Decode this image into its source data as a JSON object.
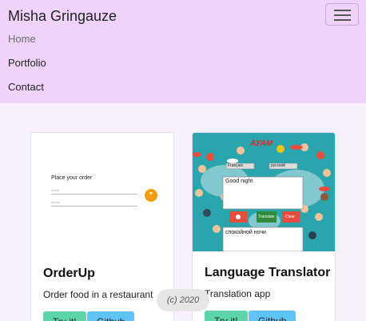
{
  "navbar": {
    "brand": "Misha Gringauze",
    "links": [
      "Home",
      "Portfolio",
      "Contact"
    ]
  },
  "projects": [
    {
      "title": "OrderUp",
      "description": "Order food in a restaurant",
      "try_label": "Try it!",
      "github_label": "Github",
      "thumb": {
        "heading": "Place your order",
        "field1": "name",
        "field2": "phone"
      }
    },
    {
      "title": "Language Translator",
      "description": "Translation app",
      "try_label": "Try it!",
      "github_label": "Github",
      "thumb": {
        "brand": "АУАМ",
        "lang_from": "Français",
        "lang_to": "русский",
        "input_text": "Good night",
        "output_text": "спокойной ночи",
        "translate_label": "Translate",
        "clear_label": "Clear"
      }
    }
  ],
  "footer": {
    "copyright": "(c) 2020"
  },
  "colors": {
    "navbar": "#efd3fb",
    "page": "#f8f0fd",
    "try": "#5cd6a8",
    "github": "#5fc4f5"
  }
}
